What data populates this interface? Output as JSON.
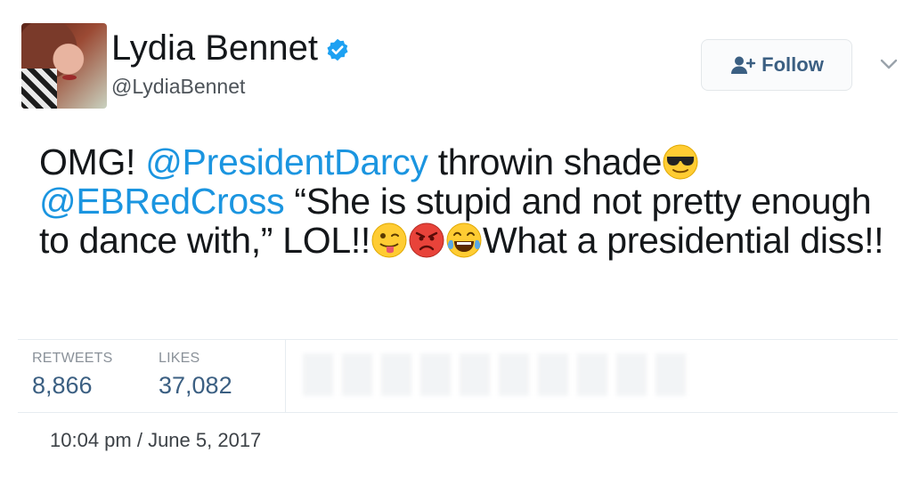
{
  "user": {
    "display_name": "Lydia Bennet",
    "handle": "@LydiaBennet"
  },
  "follow_button": {
    "label": "Follow"
  },
  "tweet": {
    "segments": {
      "s1": "OMG! ",
      "m1": "@PresidentDarcy",
      "s2": " throwin shade",
      "m2": "@EBRedCross",
      "s3": " “She is stupid and not pretty enough to dance with,” LOL!!",
      "s4": "What a presidential diss!!"
    },
    "emojis": [
      "sunglasses-emoji",
      "winking-tongue-emoji",
      "angry-emoji",
      "tears-of-joy-emoji"
    ]
  },
  "stats": {
    "retweets_label": "RETWEETS",
    "retweets_value": "8,866",
    "likes_label": "LIKES",
    "likes_value": "37,082"
  },
  "timestamp": "10:04 pm / June 5, 2017",
  "colors": {
    "link": "#1b95e0",
    "verified": "#1da1f2",
    "stat_value": "#3b5f82"
  }
}
